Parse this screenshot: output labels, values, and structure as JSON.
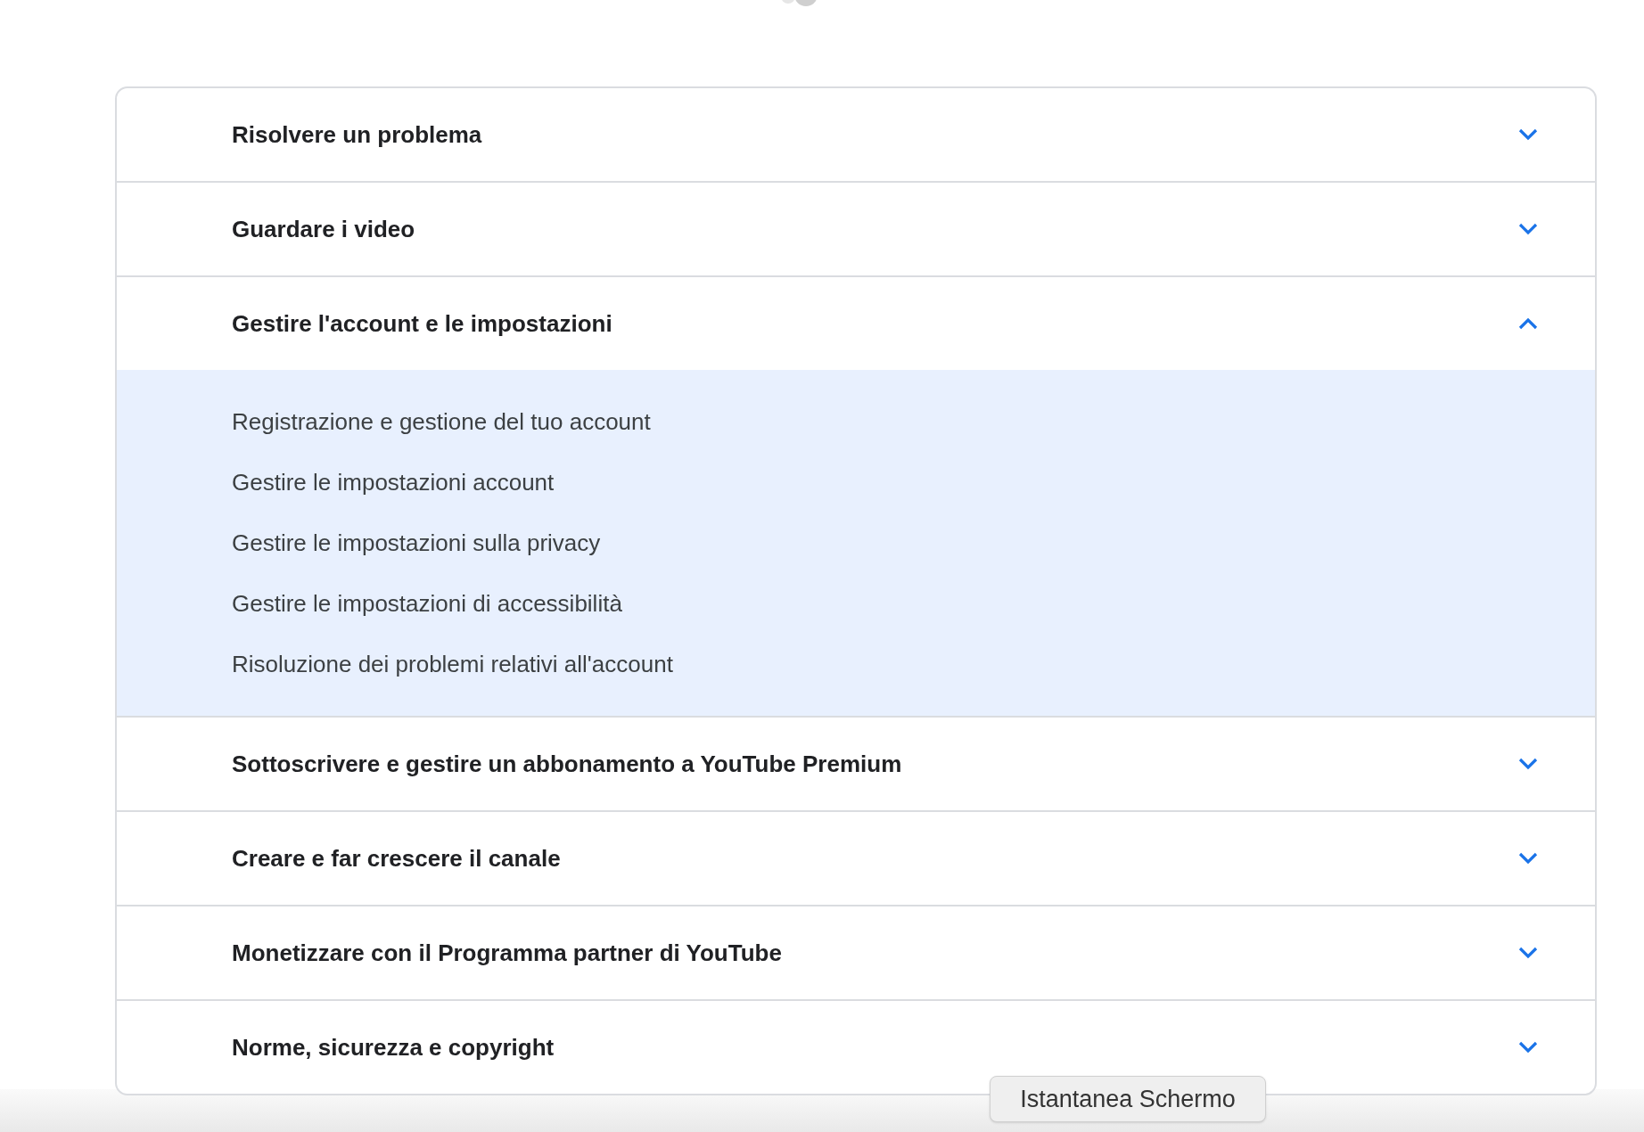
{
  "sections": [
    {
      "title": "Risolvere un problema",
      "expanded": false
    },
    {
      "title": "Guardare i video",
      "expanded": false
    },
    {
      "title": "Gestire l'account e le impostazioni",
      "expanded": true,
      "links": [
        "Registrazione e gestione del tuo account",
        "Gestire le impostazioni account",
        "Gestire le impostazioni sulla privacy",
        "Gestire le impostazioni di accessibilità",
        "Risoluzione dei problemi relativi all'account"
      ]
    },
    {
      "title": "Sottoscrivere e gestire un abbonamento a YouTube Premium",
      "expanded": false
    },
    {
      "title": "Creare e far crescere il canale",
      "expanded": false
    },
    {
      "title": "Monetizzare con il Programma partner di YouTube",
      "expanded": false
    },
    {
      "title": "Norme, sicurezza e copyright",
      "expanded": false
    }
  ],
  "tooltip": "Istantanea Schermo"
}
